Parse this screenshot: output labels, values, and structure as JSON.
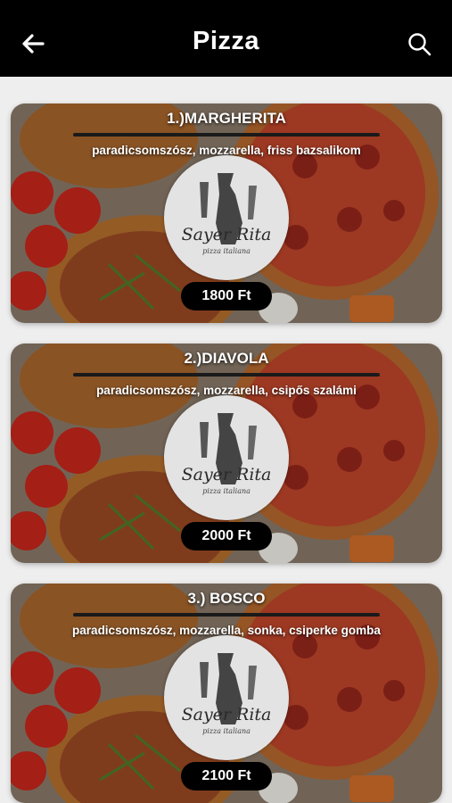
{
  "header": {
    "title": "Pizza",
    "back_icon": "arrow-left-icon",
    "search_icon": "search-icon"
  },
  "menu": {
    "items": [
      {
        "name": "1.)MARGHERITA",
        "description": "paradicsomszósz, mozzarella, friss bazsalikom",
        "price": "1800 Ft"
      },
      {
        "name": "2.)DIAVOLA",
        "description": "paradicsomszósz, mozzarella, csipős szalámi",
        "price": "2000 Ft"
      },
      {
        "name": "3.) BOSCO",
        "description": "paradicsomszósz, mozzarella, sonka, csiperke gomba",
        "price": "2100 Ft"
      }
    ]
  },
  "logo": {
    "script_text": "Sayer Rita",
    "subtitle": "pizza italiana"
  },
  "colors": {
    "header_bg": "#000000",
    "price_badge_bg": "#000000",
    "text_white": "#ffffff"
  }
}
